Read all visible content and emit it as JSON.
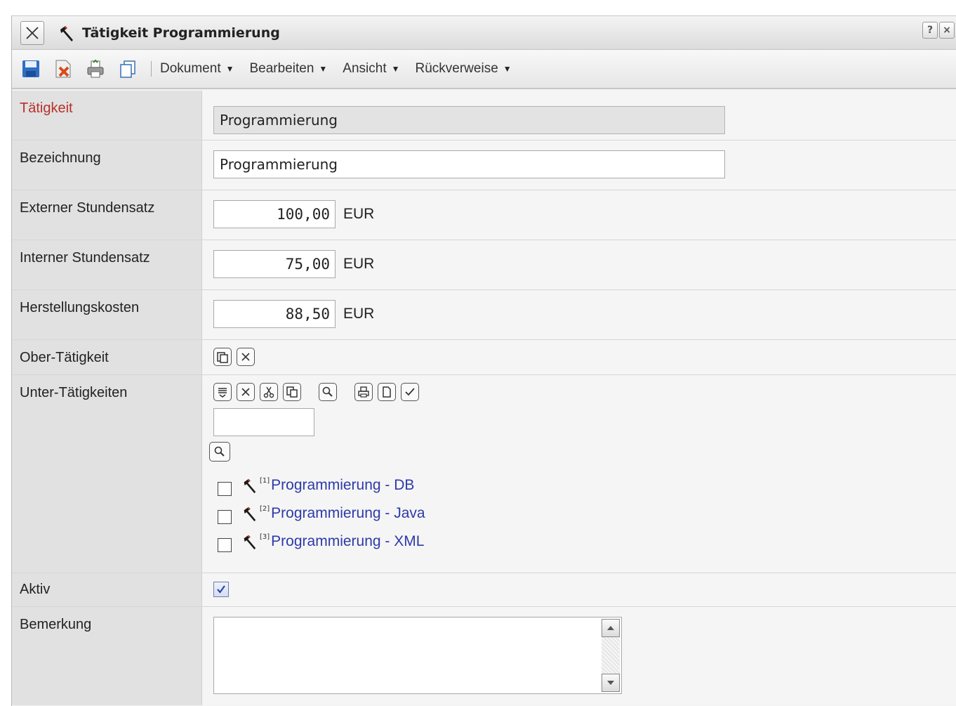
{
  "window": {
    "title": "Tätigkeit Programmierung",
    "help_label": "?",
    "close_label": "×"
  },
  "toolbar": {
    "icons": [
      "save-icon",
      "delete-document-icon",
      "print-icon",
      "copy-icon"
    ],
    "menus": [
      {
        "label": "Dokument"
      },
      {
        "label": "Bearbeiten"
      },
      {
        "label": "Ansicht"
      },
      {
        "label": "Rückverweise"
      }
    ]
  },
  "form": {
    "taetigkeit": {
      "label": "Tätigkeit",
      "value": "Programmierung"
    },
    "bezeichnung": {
      "label": "Bezeichnung",
      "value": "Programmierung"
    },
    "ext_rate": {
      "label": "Externer Stundensatz",
      "value": "100,00",
      "unit": "EUR"
    },
    "int_rate": {
      "label": "Interner Stundensatz",
      "value": "75,00",
      "unit": "EUR"
    },
    "herstellkosten": {
      "label": "Herstellungskosten",
      "value": "88,50",
      "unit": "EUR"
    },
    "ober": {
      "label": "Ober-Tätigkeit"
    },
    "unter": {
      "label": "Unter-Tätigkeiten",
      "search_value": "",
      "items": [
        {
          "ref": "[1]",
          "label": "Programmierung - DB",
          "checked": false
        },
        {
          "ref": "[2]",
          "label": "Programmierung - Java",
          "checked": false
        },
        {
          "ref": "[3]",
          "label": "Programmierung - XML",
          "checked": false
        }
      ]
    },
    "aktiv": {
      "label": "Aktiv",
      "checked": true
    },
    "bemerkung": {
      "label": "Bemerkung",
      "value": ""
    }
  },
  "colors": {
    "required_label": "#b8302a",
    "link": "#2d3aa8",
    "label_bg": "#e1e1e1",
    "value_bg": "#f5f5f5"
  }
}
